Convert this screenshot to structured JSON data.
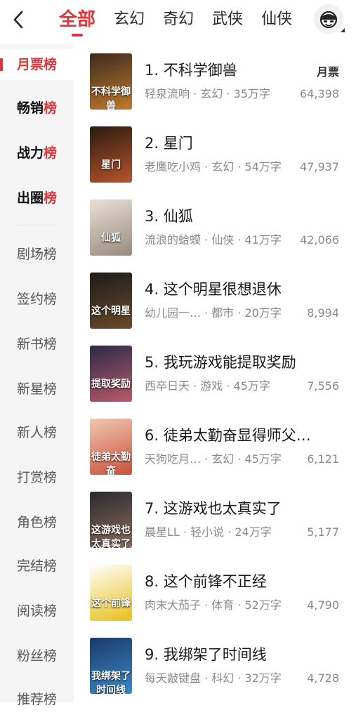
{
  "header": {
    "tabs": [
      "全部",
      "玄幻",
      "奇幻",
      "武侠",
      "仙侠"
    ],
    "active_tab": 0
  },
  "sidebar": {
    "items": [
      {
        "pre": "月票",
        "hl": "榜"
      },
      {
        "pre": "畅销",
        "hl": "榜"
      },
      {
        "pre": "战力",
        "hl": "榜"
      },
      {
        "pre": "出圈",
        "hl": "榜"
      },
      {
        "pre": "剧场榜",
        "hl": ""
      },
      {
        "pre": "签约榜",
        "hl": ""
      },
      {
        "pre": "新书榜",
        "hl": ""
      },
      {
        "pre": "新星榜",
        "hl": ""
      },
      {
        "pre": "新人榜",
        "hl": ""
      },
      {
        "pre": "打赏榜",
        "hl": ""
      },
      {
        "pre": "角色榜",
        "hl": ""
      },
      {
        "pre": "完结榜",
        "hl": ""
      },
      {
        "pre": "阅读榜",
        "hl": ""
      },
      {
        "pre": "粉丝榜",
        "hl": ""
      },
      {
        "pre": "推荐榜",
        "hl": ""
      }
    ]
  },
  "list": {
    "column_label": "月票",
    "books": [
      {
        "title": "1. 不科学御兽",
        "meta": "轻泉流响 · 玄幻 · 35万字",
        "count": "64,398",
        "cover_text": "不科学御兽",
        "cover_colors": [
          "#3a2a1e",
          "#c47a2c"
        ]
      },
      {
        "title": "2. 星门",
        "meta": "老鹰吃小鸡 · 玄幻 · 54万字",
        "count": "47,937",
        "cover_text": "星门",
        "cover_colors": [
          "#2a1a12",
          "#b8552a"
        ]
      },
      {
        "title": "3. 仙狐",
        "meta": "流浪的蛤蟆 · 仙侠 · 41万字",
        "count": "42,066",
        "cover_text": "仙狐",
        "cover_colors": [
          "#e8e0d8",
          "#9a8a7c"
        ]
      },
      {
        "title": "4. 这个明星很想退休",
        "meta": "幼儿园一…  · 都市 · 20万字",
        "count": "8,994",
        "cover_text": "这个明星",
        "cover_colors": [
          "#1c1c1c",
          "#6a4a2a"
        ]
      },
      {
        "title": "5. 我玩游戏能提取奖励",
        "meta": "西卒日天 · 游戏 · 45万字",
        "count": "7,556",
        "cover_text": "提取奖励",
        "cover_colors": [
          "#2a2a48",
          "#b85a68"
        ]
      },
      {
        "title": "6. 徒弟太勤奋显得师父…",
        "meta": "天狗吃月…  · 玄幻 · 45万字",
        "count": "6,121",
        "cover_text": "徒弟太勤奋",
        "cover_colors": [
          "#f0c8b0",
          "#c8503a"
        ]
      },
      {
        "title": "7. 这游戏也太真实了",
        "meta": "晨星LL · 轻小说 · 24万字",
        "count": "5,177",
        "cover_text": "这游戏也太真实了",
        "cover_colors": [
          "#2a2a30",
          "#8a6a5a"
        ]
      },
      {
        "title": "8. 这个前锋不正经",
        "meta": "肉末大茄子 · 体育 · 52万字",
        "count": "4,790",
        "cover_text": "这个前锋",
        "cover_colors": [
          "#ffffff",
          "#e8c018"
        ]
      },
      {
        "title": "9. 我绑架了时间线",
        "meta": "每天敲键盘 · 科幻 · 32万字",
        "count": "4,728",
        "cover_text": "我绑架了时间线",
        "cover_colors": [
          "#1a3a6a",
          "#3a8ac8"
        ]
      }
    ]
  },
  "colors": {
    "accent": "#e0353a",
    "sidebar_bg": "#f5f5f5",
    "meta_text": "#8a8a8a"
  },
  "icons": {
    "back": "chevron-left-icon",
    "avatar": "avatar-icon"
  }
}
